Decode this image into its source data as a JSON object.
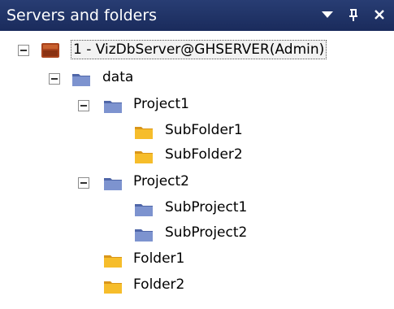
{
  "panel": {
    "title": "Servers and folders",
    "controls": {
      "dropdown": "▼",
      "pin": "ᵽ",
      "close": "✕"
    }
  },
  "tree": {
    "server": {
      "label": "1 - VizDbServer@GHSERVER(Admin)",
      "icon": "server-icon"
    },
    "data": {
      "label": "data",
      "icon": "blue-folder-icon"
    },
    "project1": {
      "label": "Project1",
      "icon": "blue-folder-icon"
    },
    "subfolder1": {
      "label": "SubFolder1",
      "icon": "yellow-folder-icon"
    },
    "subfolder2": {
      "label": "SubFolder2",
      "icon": "yellow-folder-icon"
    },
    "project2": {
      "label": "Project2",
      "icon": "blue-folder-icon"
    },
    "subproject1": {
      "label": "SubProject1",
      "icon": "blue-folder-icon"
    },
    "subproject2": {
      "label": "SubProject2",
      "icon": "blue-folder-icon"
    },
    "folder1": {
      "label": "Folder1",
      "icon": "yellow-folder-icon"
    },
    "folder2": {
      "label": "Folder2",
      "icon": "yellow-folder-icon"
    }
  },
  "colors": {
    "titlebar": "#1f3166",
    "blue_folder": "#6f86c4",
    "yellow_folder": "#f5b51d",
    "server": "#a8421c"
  }
}
